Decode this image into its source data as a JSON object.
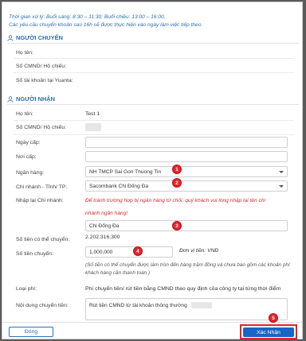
{
  "notice": {
    "line1": "Thời gian xử lý: Buổi sáng: 8:30 – 11:30; Buổi chiều: 13:00 – 16:00.",
    "line2": "Các yêu cầu chuyển khoản sau 16h sẽ được thực hiện vào ngày làm việc tiếp theo."
  },
  "sender": {
    "title": "NGƯỜI CHUYỂN",
    "name_label": "Họ tên:",
    "id_label": "Số CMND/ Hộ chiếu:",
    "account_label": "Số tài khoản tại Yuanta:"
  },
  "receiver": {
    "title": "NGƯỜI NHẬN",
    "name_label": "Họ tên:",
    "name_value": "Test 1",
    "id_label": "Số CMND/ Hộ chiếu:",
    "issue_date_label": "Ngày cấp:",
    "issue_place_label": "Nơi cấp:",
    "bank_label": "Ngân hàng:",
    "bank_value": "NH TMCP Sai Gon Thuong Tin",
    "branch_label": "Chi nhánh - Tỉnh/ TP:",
    "branch_value": "Sacombank CN Đống Đa",
    "reenter_label": "Nhập lại Chi nhánh:",
    "warning_line1": "Để tránh trường hợp bị ngân hàng từ chối, quý khách vui lòng nhập lại tên chi",
    "warning_line2": "nhánh ngân hàng!",
    "reenter_value": "CN Đống Đa",
    "available_label": "Số tiền có thể chuyển:",
    "available_value": "2.202.316.300",
    "amount_label": "Số tiền chuyển:",
    "amount_value": "1,000,000",
    "unit": "Đơn vị tiền: VNĐ",
    "amount_note": "(Số tiền có thể chuyển được làm tròn đến hàng trăm đồng và chưa bao gồm các khoản phí khách hàng cần thanh toán.)",
    "fee_label": "Loại phí:",
    "fee_value": "Phí chuyển tiền/ rút tiền bằng CMND theo quy định của công ty tại từng thời điểm",
    "content_label": "Nội dung chuyển tiền:",
    "content_value": "Rút tiền CMND từ tài khoản thông thường"
  },
  "badges": [
    "1",
    "2",
    "3",
    "4",
    "5"
  ],
  "footer": {
    "close_label": "Đóng",
    "confirm_label": "Xác Nhận"
  },
  "colors": {
    "accent": "#2a6fb5",
    "primary_button": "#1a64c6",
    "highlight": "#e3232c"
  }
}
